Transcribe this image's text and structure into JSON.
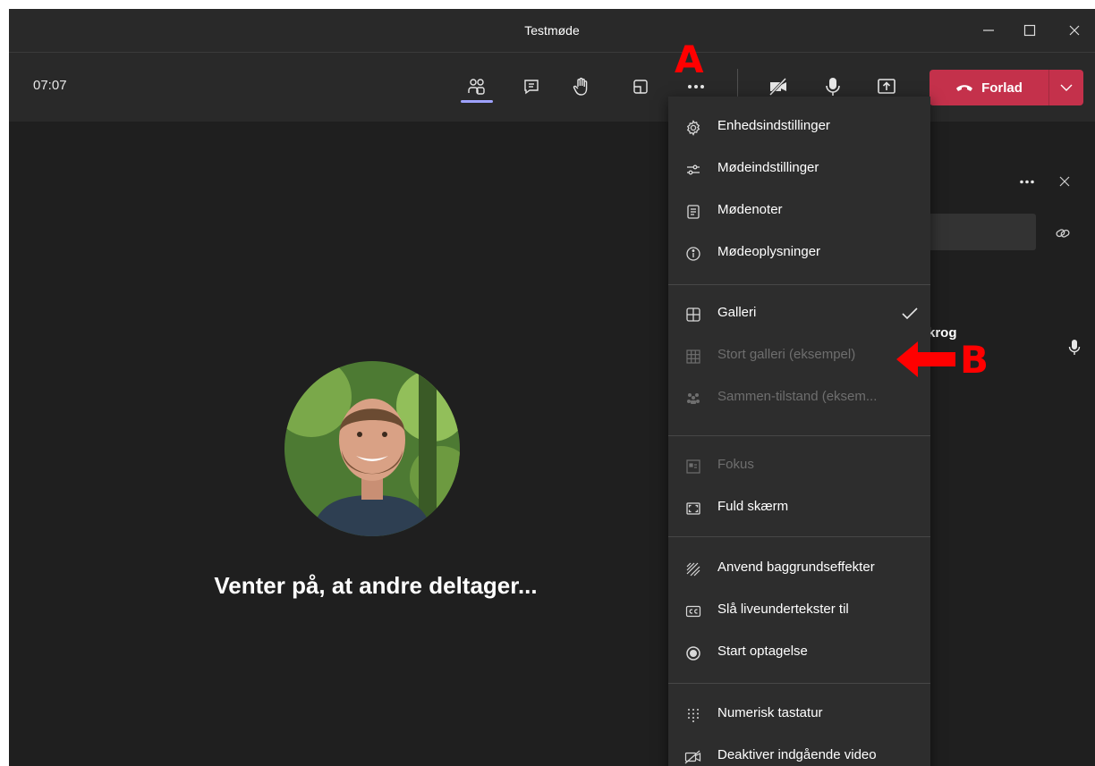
{
  "window": {
    "title": "Testmøde"
  },
  "toolbar": {
    "timer": "07:07",
    "leave_label": "Forlad"
  },
  "stage": {
    "waiting_text": "Venter på, at andre deltager..."
  },
  "side_panel": {
    "participant_name_fragment": "krog"
  },
  "menu": {
    "items": [
      {
        "label": "Enhedsindstillinger",
        "icon": "gear-icon"
      },
      {
        "label": "Mødeindstillinger",
        "icon": "sliders-icon"
      },
      {
        "label": "Mødenoter",
        "icon": "notes-icon"
      },
      {
        "label": "Mødeoplysninger",
        "icon": "info-icon"
      },
      {
        "label": "Galleri",
        "icon": "gallery-icon",
        "checked": true
      },
      {
        "label": "Stort galleri (eksempel)",
        "icon": "large-gallery-icon",
        "disabled": true
      },
      {
        "label": "Sammen-tilstand (eksem...",
        "icon": "together-mode-icon",
        "disabled": true
      },
      {
        "label": "Fokus",
        "icon": "focus-icon",
        "disabled": true
      },
      {
        "label": "Fuld skærm",
        "icon": "fullscreen-icon"
      },
      {
        "label": "Anvend baggrundseffekter",
        "icon": "background-effects-icon"
      },
      {
        "label": "Slå liveundertekster til",
        "icon": "captions-icon"
      },
      {
        "label": "Start optagelse",
        "icon": "record-icon"
      },
      {
        "label": "Numerisk tastatur",
        "icon": "keypad-icon"
      },
      {
        "label": "Deaktiver indgående video",
        "icon": "video-off-icon"
      }
    ]
  },
  "annotations": {
    "a": "A",
    "b": "B"
  },
  "colors": {
    "accent": "#9ea2ff",
    "leave": "#c4314b",
    "annotation": "#ff0000"
  }
}
